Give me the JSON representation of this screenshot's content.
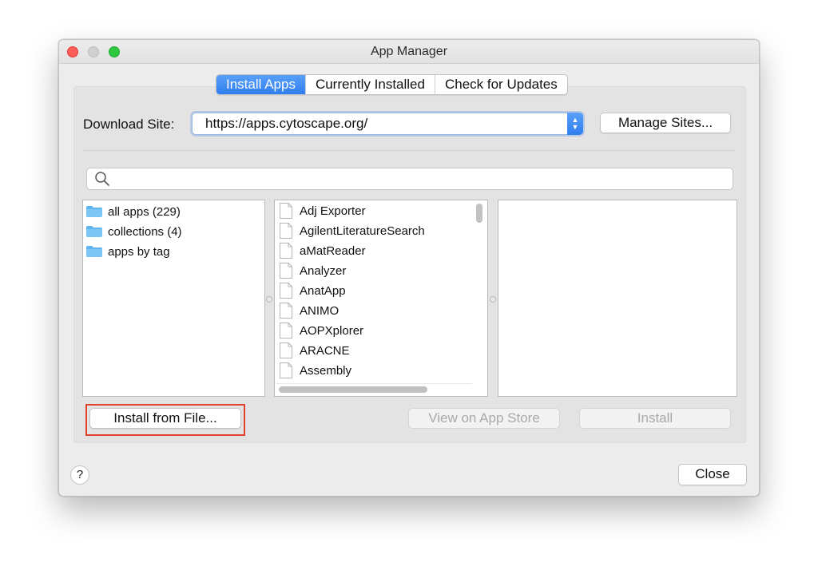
{
  "window": {
    "title": "App Manager"
  },
  "tabs": [
    {
      "label": "Install Apps",
      "active": true
    },
    {
      "label": "Currently Installed",
      "active": false
    },
    {
      "label": "Check for Updates",
      "active": false
    }
  ],
  "download": {
    "label": "Download Site:",
    "url": "https://apps.cytoscape.org/",
    "manage_label": "Manage Sites..."
  },
  "search": {
    "value": "",
    "placeholder": ""
  },
  "categories": [
    {
      "label": "all apps (229)",
      "icon": "folder-icon"
    },
    {
      "label": "collections (4)",
      "icon": "folder-icon"
    },
    {
      "label": "apps by tag",
      "icon": "folder-icon"
    }
  ],
  "apps": [
    "Adj Exporter",
    "AgilentLiteratureSearch",
    "aMatReader",
    "Analyzer",
    "AnatApp",
    "ANIMO",
    "AOPXplorer",
    "ARACNE",
    "Assembly"
  ],
  "actions": {
    "install_from_file": "Install from File...",
    "view_on_store": "View on App Store",
    "install": "Install"
  },
  "footer": {
    "help": "?",
    "close": "Close"
  },
  "colors": {
    "accent": "#2f7ef0",
    "highlight_border": "#e0422c",
    "close_button_red": "#fd5e57",
    "zoom_button_green": "#2dc840"
  }
}
